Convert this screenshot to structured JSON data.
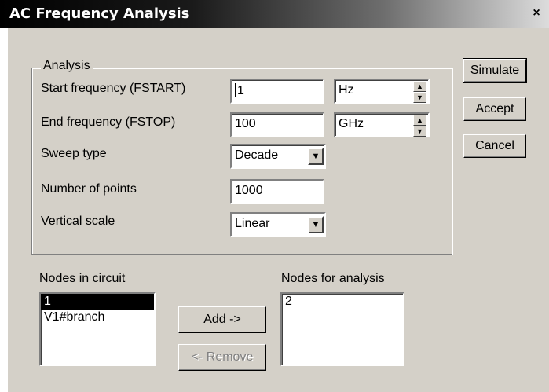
{
  "window": {
    "title": "AC Frequency Analysis",
    "close_glyph": "×"
  },
  "analysis": {
    "group_label": "Analysis",
    "start_label": "Start frequency (FSTART)",
    "start_value": "1",
    "start_unit": "Hz",
    "end_label": "End frequency (FSTOP)",
    "end_value": "100",
    "end_unit": "GHz",
    "sweep_label": "Sweep type",
    "sweep_value": "Decade",
    "points_label": "Number of points",
    "points_value": "1000",
    "scale_label": "Vertical scale",
    "scale_value": "Linear"
  },
  "buttons": {
    "simulate": "Simulate",
    "accept": "Accept",
    "cancel": "Cancel",
    "add": "Add ->",
    "remove": "<- Remove"
  },
  "nodes_in_circuit": {
    "label": "Nodes in circuit",
    "items": [
      "1",
      "V1#branch"
    ],
    "selected_index": 0
  },
  "nodes_for_analysis": {
    "label": "Nodes for analysis",
    "items": [
      "2"
    ]
  },
  "icons": {
    "spin_up": "▲",
    "spin_down": "▼",
    "dropdown": "▼"
  }
}
